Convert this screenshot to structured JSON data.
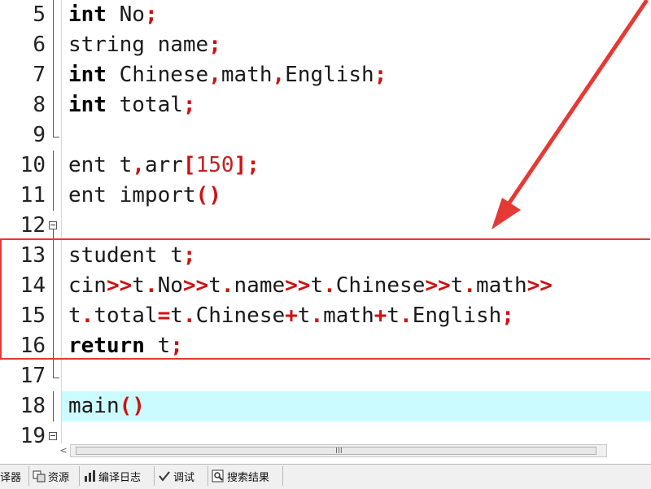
{
  "editor": {
    "lines": [
      {
        "no": "5",
        "tokens": [
          {
            "t": "int",
            "c": "kw"
          },
          {
            "t": " No"
          },
          {
            "t": ";",
            "c": "op"
          }
        ]
      },
      {
        "no": "6",
        "tokens": [
          {
            "t": "string name"
          },
          {
            "t": ";",
            "c": "op"
          }
        ]
      },
      {
        "no": "7",
        "tokens": [
          {
            "t": "int",
            "c": "kw"
          },
          {
            "t": " Chinese"
          },
          {
            "t": ",",
            "c": "op"
          },
          {
            "t": "math"
          },
          {
            "t": ",",
            "c": "op"
          },
          {
            "t": "English"
          },
          {
            "t": ";",
            "c": "op"
          }
        ]
      },
      {
        "no": "8",
        "tokens": [
          {
            "t": "int",
            "c": "kw"
          },
          {
            "t": " total"
          },
          {
            "t": ";",
            "c": "op"
          }
        ]
      },
      {
        "no": "9",
        "tokens": []
      },
      {
        "no": "10",
        "tokens": [
          {
            "t": "ent t"
          },
          {
            "t": ",",
            "c": "op"
          },
          {
            "t": "arr"
          },
          {
            "t": "[",
            "c": "op"
          },
          {
            "t": "150",
            "c": "num"
          },
          {
            "t": "]",
            "c": "op"
          },
          {
            "t": ";",
            "c": "op"
          }
        ]
      },
      {
        "no": "11",
        "tokens": [
          {
            "t": "ent import"
          },
          {
            "t": "()",
            "c": "op"
          }
        ]
      },
      {
        "no": "12",
        "tokens": []
      },
      {
        "no": "13",
        "tokens": [
          {
            "t": "student t"
          },
          {
            "t": ";",
            "c": "op"
          }
        ]
      },
      {
        "no": "14",
        "tokens": [
          {
            "t": "cin"
          },
          {
            "t": ">>",
            "c": "op"
          },
          {
            "t": "t"
          },
          {
            "t": ".",
            "c": "op"
          },
          {
            "t": "No"
          },
          {
            "t": ">>",
            "c": "op"
          },
          {
            "t": "t"
          },
          {
            "t": ".",
            "c": "op"
          },
          {
            "t": "name"
          },
          {
            "t": ">>",
            "c": "op"
          },
          {
            "t": "t"
          },
          {
            "t": ".",
            "c": "op"
          },
          {
            "t": "Chinese"
          },
          {
            "t": ">>",
            "c": "op"
          },
          {
            "t": "t"
          },
          {
            "t": ".",
            "c": "op"
          },
          {
            "t": "math"
          },
          {
            "t": ">>",
            "c": "op"
          }
        ]
      },
      {
        "no": "15",
        "tokens": [
          {
            "t": "t"
          },
          {
            "t": ".",
            "c": "op"
          },
          {
            "t": "total"
          },
          {
            "t": "=",
            "c": "op"
          },
          {
            "t": "t"
          },
          {
            "t": ".",
            "c": "op"
          },
          {
            "t": "Chinese"
          },
          {
            "t": "+",
            "c": "op"
          },
          {
            "t": "t"
          },
          {
            "t": ".",
            "c": "op"
          },
          {
            "t": "math"
          },
          {
            "t": "+",
            "c": "op"
          },
          {
            "t": "t"
          },
          {
            "t": ".",
            "c": "op"
          },
          {
            "t": "English"
          },
          {
            "t": ";",
            "c": "op"
          }
        ]
      },
      {
        "no": "16",
        "tokens": [
          {
            "t": "return",
            "c": "kw"
          },
          {
            "t": " t"
          },
          {
            "t": ";",
            "c": "op"
          }
        ]
      },
      {
        "no": "17",
        "tokens": []
      },
      {
        "no": "18",
        "tokens": [
          {
            "t": "main"
          },
          {
            "t": "()",
            "c": "op"
          }
        ]
      },
      {
        "no": "19",
        "tokens": []
      }
    ],
    "highlighted_line": "18"
  },
  "scrollbar": {
    "left_arrow": "<",
    "grip": "III"
  },
  "tabs": [
    {
      "label": "译器",
      "icon": "compiler-icon"
    },
    {
      "label": "资源",
      "icon": "resources-icon"
    },
    {
      "label": "编译日志",
      "icon": "chart-icon"
    },
    {
      "label": "调试",
      "icon": "checkmark-icon"
    },
    {
      "label": "搜索结果",
      "icon": "search-results-icon"
    }
  ],
  "colors": {
    "annotation": "#e53935",
    "highlight": "#ccfbff",
    "operator": "#d01010"
  }
}
